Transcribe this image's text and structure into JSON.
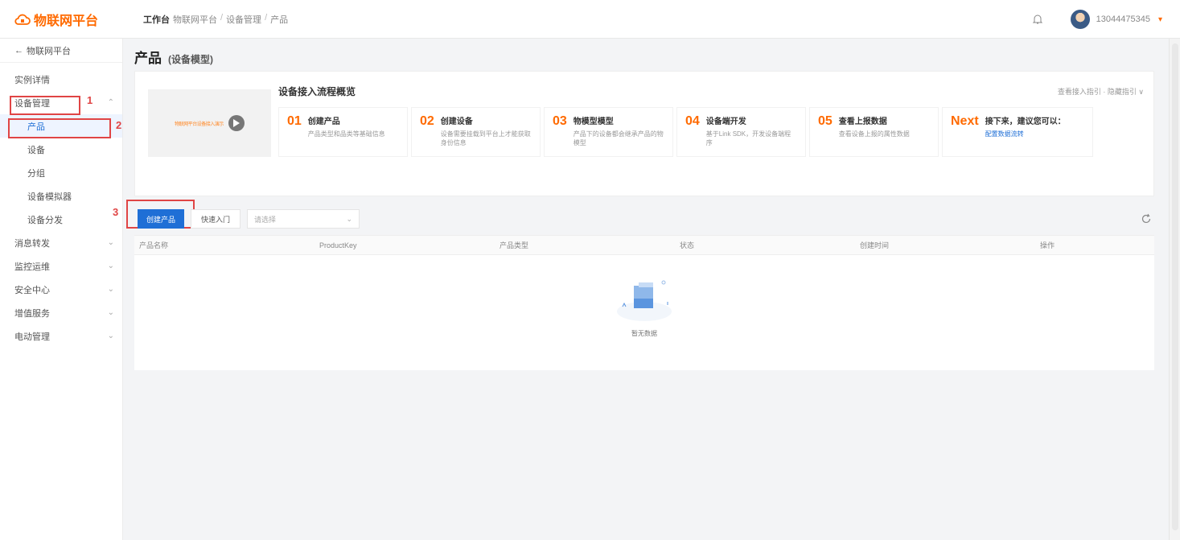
{
  "header": {
    "logo_text": "物联网平台",
    "breadcrumb": [
      "工作台",
      "物联网平台",
      "设备管理",
      "产品"
    ],
    "account_name": "13044475345",
    "account_caret": "▾"
  },
  "sidebar": {
    "back_label": "物联网平台",
    "items": [
      {
        "label": "实例详情"
      },
      {
        "label": "设备管理"
      },
      {
        "label": "产品"
      },
      {
        "label": "设备"
      },
      {
        "label": "分组"
      },
      {
        "label": "设备模拟器"
      },
      {
        "label": "设备分发"
      },
      {
        "label": "消息转发"
      },
      {
        "label": "监控运维"
      },
      {
        "label": "安全中心"
      },
      {
        "label": "增值服务"
      },
      {
        "label": "电动管理"
      }
    ]
  },
  "annotations": [
    "1",
    "2",
    "3"
  ],
  "page": {
    "title": "产品",
    "subtitle": "(设备模型)"
  },
  "flow": {
    "title": "设备接入流程概览",
    "links": "查看接入指引 · 隐藏指引 ∨",
    "video_label": "物联网平台设备接入演示",
    "steps": [
      {
        "num": "01",
        "name": "创建产品",
        "desc": "产品类型和品类等基础信息"
      },
      {
        "num": "02",
        "name": "创建设备",
        "desc": "设备需要挂载到平台上才能获取身份信息"
      },
      {
        "num": "03",
        "name": "物模型模型",
        "desc": "产品下的设备都会继承产品的物模型"
      },
      {
        "num": "04",
        "name": "设备端开发",
        "desc": "基于Link SDK，开发设备端程序"
      },
      {
        "num": "05",
        "name": "查看上报数据",
        "desc": "查看设备上报的属性数据"
      },
      {
        "num": "Next",
        "name": "接下来，建议您可以：",
        "desc": "",
        "link": "配置数据流转"
      }
    ]
  },
  "toolbar": {
    "create_label": "创建产品",
    "quick_label": "快速入门",
    "select_placeholder": "请选择"
  },
  "table": {
    "columns": [
      "产品名称",
      "ProductKey",
      "产品类型",
      "状态",
      "创建时间",
      "操作"
    ],
    "empty_text": "暂无数据"
  },
  "colors": {
    "brand": "#ff6a00",
    "primary": "#1f6fd6",
    "annotation": "#e04545"
  }
}
